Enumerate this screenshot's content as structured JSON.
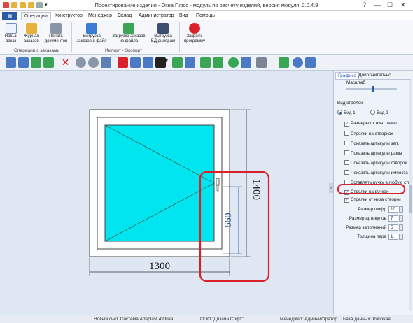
{
  "window": {
    "title": "Проектирование изделия - Окна Плюс - модуль по расчету изделий, версия модуля: 2.0.4.9",
    "help_glyph": "?",
    "min_glyph": "—",
    "max_glyph": "☐",
    "close_glyph": "✕"
  },
  "menu_tabs": [
    "Операции",
    "Конструктор",
    "Менеджер",
    "Склад",
    "Администратор",
    "Вид",
    "Помощь"
  ],
  "ribbon": {
    "buttons": [
      {
        "line1": "Новый",
        "line2": "заказ"
      },
      {
        "line1": "Журнал",
        "line2": "заказов"
      },
      {
        "line1": "Печать",
        "line2": "документов"
      },
      {
        "line1": "Выгрузка",
        "line2": "заказов в файл"
      },
      {
        "line1": "Загрузка заказов",
        "line2": "из файла"
      },
      {
        "line1": "Выгрузка",
        "line2": "БД дилерам"
      },
      {
        "line1": "Закрыть",
        "line2": "программу"
      }
    ],
    "groups": [
      "Операции с заказами",
      "Импорт - Экспорт"
    ]
  },
  "drawing": {
    "width_label": "1300",
    "height_label": "1400",
    "handle_label": "660"
  },
  "panel": {
    "tabs": [
      "Графика",
      "Дополнительно"
    ],
    "scale_label": "Масштаб",
    "arrow_view_label": "Вид стрелок:",
    "view_options": [
      "Вид 1",
      "Вид 2"
    ],
    "checkboxes": [
      {
        "label": "Размеры от нин. рамы",
        "checked": true
      },
      {
        "label": "Стрелки на створках",
        "checked": false
      },
      {
        "label": "Показать артикулы зап.",
        "checked": false
      },
      {
        "label": "Показать артикулы рамы",
        "checked": false
      },
      {
        "label": "Показать артикулы створок",
        "checked": false
      },
      {
        "label": "Показать артикулы импоста",
        "checked": false
      },
      {
        "label": "Вставлять ручку в любую ств",
        "checked": false
      },
      {
        "label": "Стрелки на ручках",
        "checked": true
      },
      {
        "label": "Стрелки от низа створки",
        "checked": true
      }
    ],
    "fields": [
      {
        "label": "Размер шифр",
        "value": "10"
      },
      {
        "label": "Размер артикулов",
        "value": "7"
      },
      {
        "label": "Размер заполнений",
        "value": "5"
      },
      {
        "label": "Толщина пера",
        "value": "1"
      }
    ]
  },
  "status": {
    "left": "Новый счет. Система Adeplast 4\\Окна",
    "company": "ООО \"Дизайн Софт\"",
    "manager": "Менеджер: Администратор",
    "db": "База данных: Рабочая"
  },
  "colors": {
    "accent": "#2b5aa8",
    "glass": "#00e5ee",
    "highlight": "#d9212b"
  }
}
